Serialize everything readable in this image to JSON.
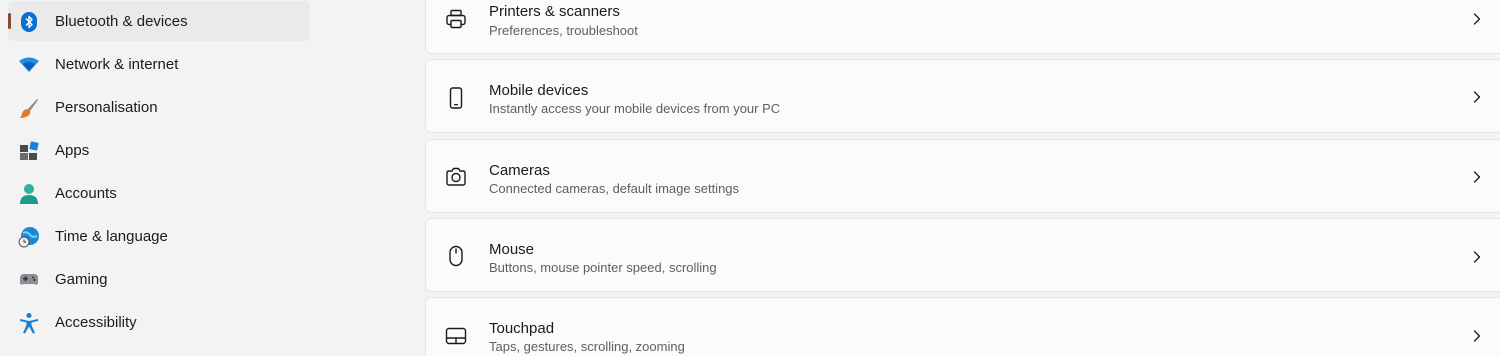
{
  "sidebar": {
    "items": [
      {
        "label": "Bluetooth & devices",
        "icon": "bluetooth-icon",
        "selected": true
      },
      {
        "label": "Network & internet",
        "icon": "wifi-icon"
      },
      {
        "label": "Personalisation",
        "icon": "brush-icon"
      },
      {
        "label": "Apps",
        "icon": "apps-icon"
      },
      {
        "label": "Accounts",
        "icon": "accounts-icon"
      },
      {
        "label": "Time & language",
        "icon": "globe-clock-icon"
      },
      {
        "label": "Gaming",
        "icon": "gamepad-icon"
      },
      {
        "label": "Accessibility",
        "icon": "accessibility-icon"
      }
    ]
  },
  "main": {
    "cards": [
      {
        "title": "Printers & scanners",
        "subtitle": "Preferences, troubleshoot",
        "icon": "printer-icon"
      },
      {
        "title": "Mobile devices",
        "subtitle": "Instantly access your mobile devices from your PC",
        "icon": "phone-icon"
      },
      {
        "title": "Cameras",
        "subtitle": "Connected cameras, default image settings",
        "icon": "camera-icon"
      },
      {
        "title": "Mouse",
        "subtitle": "Buttons, mouse pointer speed, scrolling",
        "icon": "mouse-icon"
      },
      {
        "title": "Touchpad",
        "subtitle": "Taps, gestures, scrolling, zooming",
        "icon": "touchpad-icon"
      }
    ]
  },
  "colors": {
    "accent": "#0067c0",
    "selection_indicator": "#8a4a3a",
    "background": "#f3f3f3",
    "card": "#fbfbfb"
  }
}
